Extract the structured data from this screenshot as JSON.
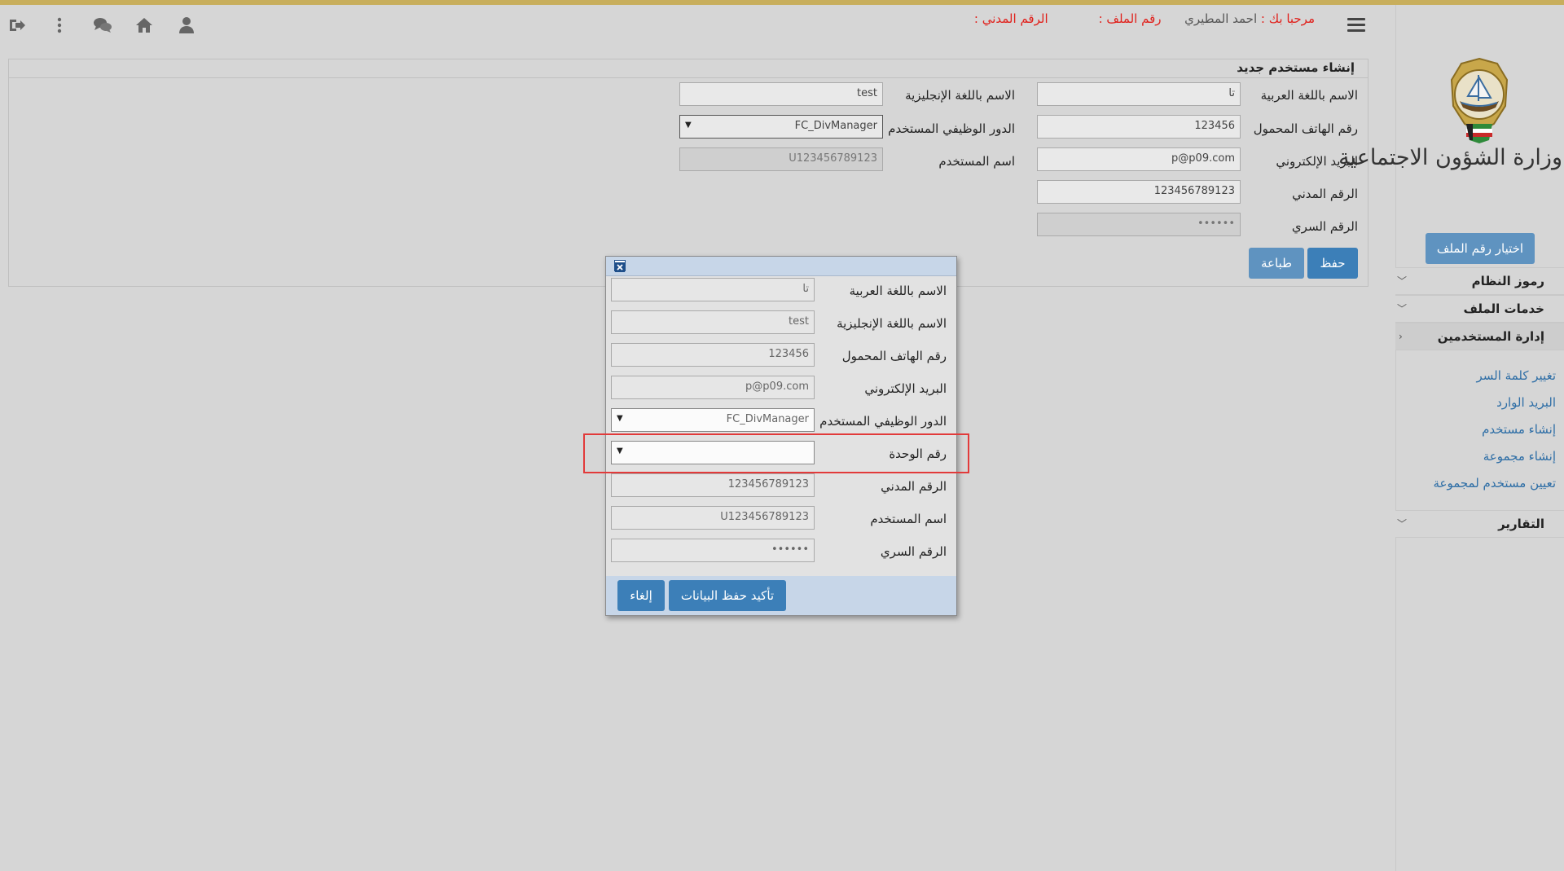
{
  "header": {
    "welcome_label": "مرحبا بك :",
    "user_name": "احمد المطيري",
    "file_no_label": "رقم الملف :",
    "civil_no_label": "الرقم المدني :",
    "icons": [
      "logout-icon",
      "more-icon",
      "chat-icon",
      "home-icon",
      "user-icon",
      "menu-icon"
    ]
  },
  "card": {
    "title": "إنشاء مستخدم جديد",
    "fields": {
      "name_ar_label": "الاسم باللغة العربية",
      "name_ar_value": "تا",
      "name_en_label": "الاسم باللغة الإنجليزية",
      "name_en_value": "test",
      "mobile_label": "رقم الهاتف المحمول",
      "mobile_value": "123456",
      "role_label": "الدور الوظيفي المستخدم",
      "role_value": "FC_DivManager",
      "email_label": "البريد الإلكتروني",
      "email_value": "p@p09.com",
      "username_label": "اسم المستخدم",
      "username_value": "U123456789123",
      "civil_label": "الرقم المدني",
      "civil_value": "123456789123",
      "password_label": "الرقم السري",
      "password_value": "••••••"
    },
    "save_label": "حفظ",
    "print_label": "طباعة"
  },
  "sidebar": {
    "ministry_name": "وزارة الشؤون الاجتماعية",
    "choose_file_label": "اختيار رقم الملف",
    "sections": [
      {
        "label": "رموز النظام"
      },
      {
        "label": "خدمات الملف"
      },
      {
        "label": "إدارة المستخدمين"
      },
      {
        "label": "التقارير"
      }
    ],
    "user_mgmt_links": [
      "تغيير كلمة السر",
      "البريد الوارد",
      "إنشاء مستخدم",
      "إنشاء مجموعة",
      "تعيين مستخدم لمجموعة"
    ]
  },
  "dialog": {
    "rows": [
      {
        "label": "الاسم باللغة العربية",
        "value": "تا"
      },
      {
        "label": "الاسم باللغة الإنجليزية",
        "value": "test"
      },
      {
        "label": "رقم الهاتف المحمول",
        "value": "123456"
      },
      {
        "label": "البريد الإلكتروني",
        "value": "p@p09.com"
      },
      {
        "label": "الدور الوظيفي المستخدم",
        "value": "FC_DivManager"
      },
      {
        "label": "رقم الوحدة",
        "value": ""
      },
      {
        "label": "الرقم المدني",
        "value": "123456789123"
      },
      {
        "label": "اسم المستخدم",
        "value": "U123456789123"
      },
      {
        "label": "الرقم السري",
        "value": "••••••"
      }
    ],
    "confirm_label": "تأكيد حفظ البيانات",
    "cancel_label": "إلغاء"
  },
  "colors": {
    "accent_blue": "#3c7fb8",
    "header_red": "#e0201b",
    "link_blue": "#2e6ea6",
    "highlight_red": "#e23a3a",
    "top_strip": "#c8ae5c"
  }
}
